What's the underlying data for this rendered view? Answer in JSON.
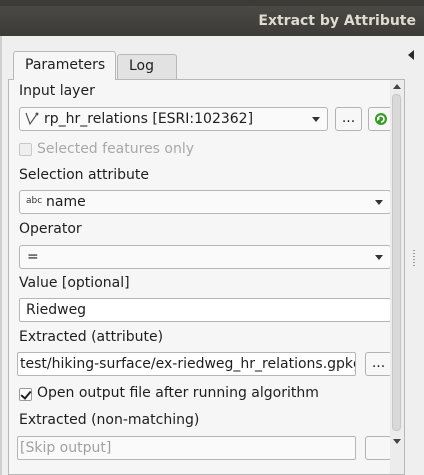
{
  "window": {
    "title": "Extract by Attribute"
  },
  "tabs": [
    {
      "label": "Parameters"
    },
    {
      "label": "Log"
    }
  ],
  "form": {
    "input_layer": {
      "label": "Input layer",
      "value": "rp_hr_relations [ESRI:102362]",
      "layer_icon": "line-layer-icon",
      "browse_label": "...",
      "iterate_icon": "iterate-refresh-icon"
    },
    "selected_only": {
      "label": "Selected features only",
      "checked": false
    },
    "selection_attribute": {
      "label": "Selection attribute",
      "type_badge": "abc",
      "value": "name"
    },
    "operator": {
      "label": "Operator",
      "value": "="
    },
    "value": {
      "label": "Value [optional]",
      "value": "Riedweg"
    },
    "extracted": {
      "label": "Extracted (attribute)",
      "value": "test/hiking-surface/ex-riedweg_hr_relations.gpkg",
      "browse_label": "..."
    },
    "open_output": {
      "label": "Open output file after running algorithm",
      "checked": true
    },
    "non_matching": {
      "label": "Extracted (non-matching)",
      "placeholder": "[Skip output]"
    }
  },
  "colors": {
    "titlebar": "#3c3b37",
    "accent_green": "#3a9a2a"
  }
}
